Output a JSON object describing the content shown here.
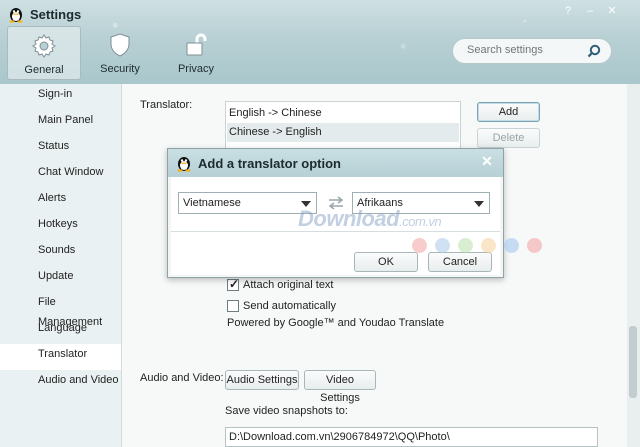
{
  "window": {
    "title": "Settings",
    "controls": [
      "?",
      "–",
      "✕"
    ]
  },
  "nav_tabs": [
    {
      "label": "General",
      "icon": "gear-icon",
      "active": true
    },
    {
      "label": "Security",
      "icon": "shield-icon",
      "active": false
    },
    {
      "label": "Privacy",
      "icon": "unlock-icon",
      "active": false
    }
  ],
  "search": {
    "placeholder": "Search settings"
  },
  "sidebar": {
    "items": [
      {
        "label": "Sign-in"
      },
      {
        "label": "Main Panel"
      },
      {
        "label": "Status"
      },
      {
        "label": "Chat Window"
      },
      {
        "label": "Alerts"
      },
      {
        "label": "Hotkeys"
      },
      {
        "label": "Sounds"
      },
      {
        "label": "Update"
      },
      {
        "label": "File Management"
      },
      {
        "label": "Language"
      },
      {
        "label": "Translator",
        "active": true
      },
      {
        "label": "Audio and Video"
      }
    ]
  },
  "translator": {
    "label": "Translator:",
    "options": [
      "English -> Chinese",
      "Chinese -> English"
    ],
    "add_button": "Add",
    "delete_button": "Delete",
    "attach_original": {
      "label": "Attach original text",
      "checked": true
    },
    "send_automatically": {
      "label": "Send automatically",
      "checked": false
    },
    "powered_by": "Powered by Google™ and Youdao Translate"
  },
  "audio_video": {
    "label": "Audio and Video:",
    "audio_settings_button": "Audio Settings",
    "video_settings_button": "Video Settings",
    "snapshot_label": "Save video snapshots to:",
    "snapshot_path": "D:\\Download.com.vn\\2906784972\\QQ\\Photo\\"
  },
  "dialog": {
    "title": "Add a translator option",
    "from_language": "Vietnamese",
    "to_language": "Afrikaans",
    "ok_button": "OK",
    "cancel_button": "Cancel",
    "close": "✕"
  },
  "watermark": {
    "text": "Download",
    "suffix": ".com.vn"
  },
  "colors": {
    "accent": "#7aa4b4",
    "header": "#b8d0d4",
    "sidebar_bg": "#eaf1f2",
    "selected_row": "#e4ebed",
    "watermark_dots": [
      "#f2a3a3",
      "#a8c8ea",
      "#b9dfa9",
      "#f7d09a",
      "#9fc3ee",
      "#f2a0a0"
    ]
  }
}
